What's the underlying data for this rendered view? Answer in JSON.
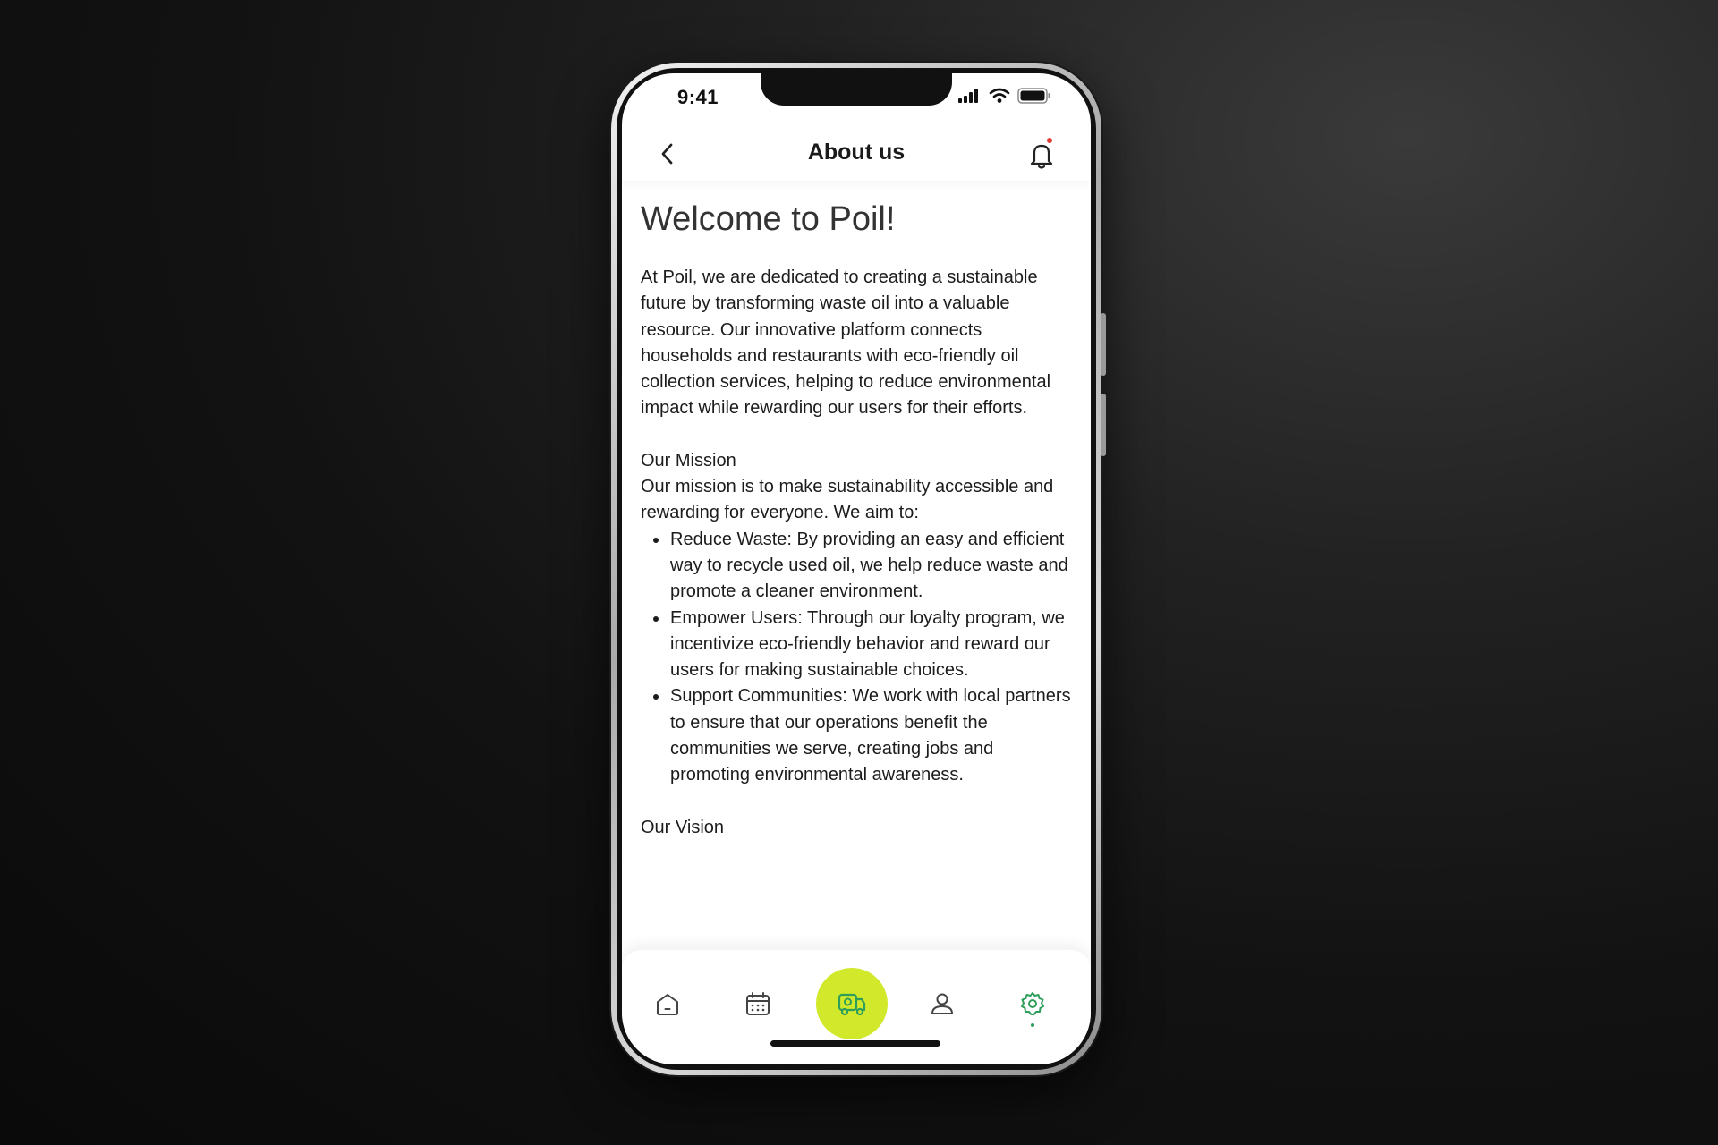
{
  "status_bar": {
    "time": "9:41"
  },
  "header": {
    "title": "About us"
  },
  "content": {
    "welcome": "Welcome to Poil!",
    "intro": "At Poil, we are dedicated to creating a sustainable future by transforming waste oil into a valuable resource. Our innovative platform connects households and restaurants with eco-friendly oil collection services, helping to reduce environmental impact while rewarding our users for their efforts.",
    "mission_title": "Our Mission",
    "mission_text": "Our mission is to make sustainability accessible and rewarding for everyone. We aim to:",
    "mission_points": [
      "Reduce Waste: By providing an easy and efficient way to recycle used oil, we help reduce waste and promote a cleaner environment.",
      "Empower Users: Through our loyalty program, we incentivize eco-friendly behavior and reward our users for making sustainable choices.",
      "Support Communities: We work with local partners to ensure that our operations benefit the communities we serve, creating jobs and promoting environmental awareness."
    ],
    "vision_title": "Our Vision"
  },
  "tabbar": {
    "items": [
      {
        "icon": "home-icon"
      },
      {
        "icon": "calendar-icon"
      },
      {
        "icon": "truck-icon",
        "highlight": "#d2e82a"
      },
      {
        "icon": "user-icon"
      },
      {
        "icon": "gear-icon",
        "active": true,
        "color": "#2e9e5b"
      }
    ]
  },
  "colors": {
    "accent": "#d2e82a",
    "active_tab": "#2e9e5b",
    "notification_dot": "#e53935"
  }
}
